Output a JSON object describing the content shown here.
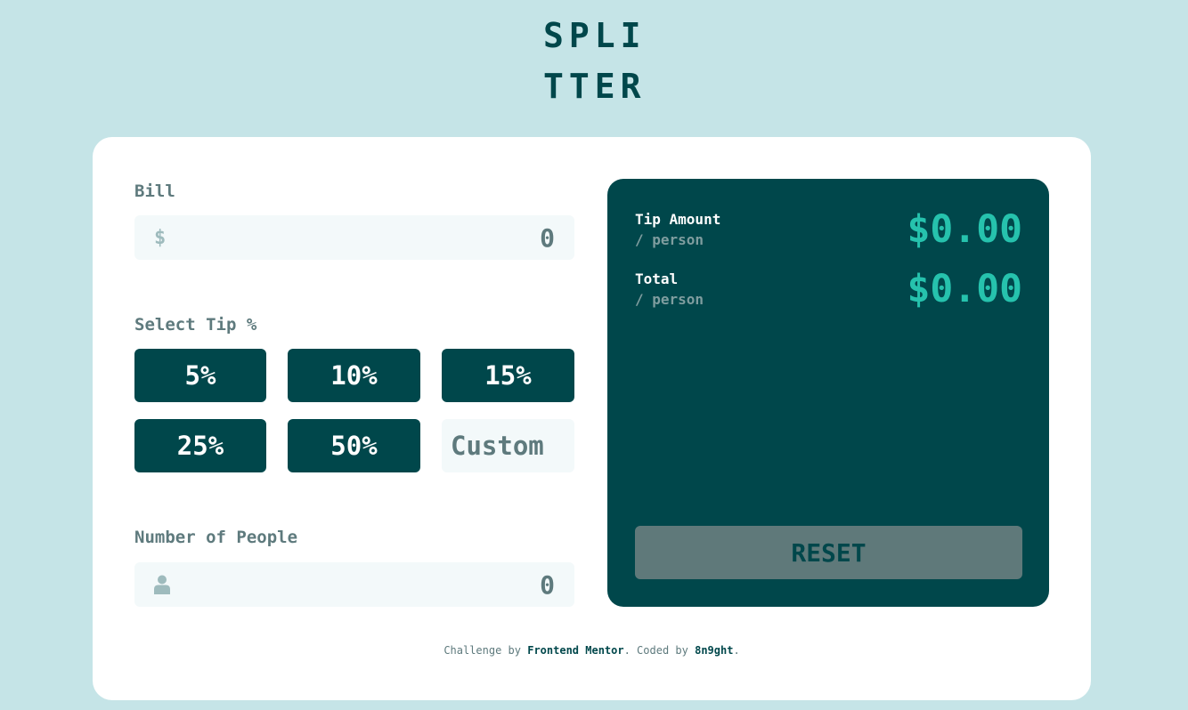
{
  "logo": {
    "line1": "SPLI",
    "line2": "TTER"
  },
  "bill": {
    "label": "Bill",
    "currency_symbol": "$",
    "value": "0"
  },
  "tip": {
    "label": "Select Tip %",
    "options": [
      "5%",
      "10%",
      "15%",
      "25%",
      "50%"
    ],
    "custom_placeholder": "Custom"
  },
  "people": {
    "label": "Number of People",
    "value": "0",
    "icon": "person-icon"
  },
  "result": {
    "tip_amount_label": "Tip Amount",
    "tip_amount_sub": "/ person",
    "tip_amount_value": "$0.00",
    "total_label": "Total",
    "total_sub": "/ person",
    "total_value": "$0.00",
    "reset_label": "RESET"
  },
  "footer": {
    "prefix": "Challenge by ",
    "challenge_link": "Frontend Mentor",
    "middle": ". Coded by ",
    "author_link": "8n9ght",
    "suffix": "."
  },
  "colors": {
    "background": "#c5e4e7",
    "dark_cyan": "#00474b",
    "accent": "#26c2ad",
    "muted": "#5e7a7d",
    "input_bg": "#f3f9fa"
  }
}
